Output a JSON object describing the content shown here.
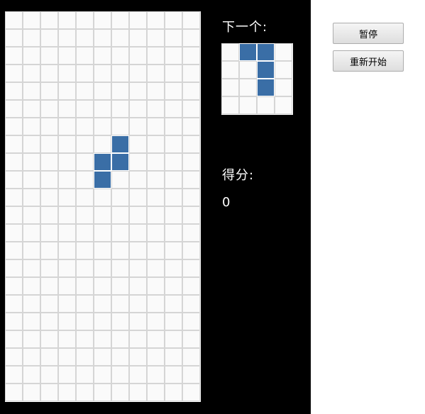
{
  "sidebar": {
    "next_label": "下一个:",
    "score_label": "得分:",
    "score_value": "0"
  },
  "controls": {
    "pause_label": "暂停",
    "restart_label": "重新开始"
  },
  "board": {
    "columns": 11,
    "rows": 22,
    "filled_cells": [
      [
        6,
        7
      ],
      [
        5,
        8
      ],
      [
        6,
        8
      ],
      [
        5,
        9
      ]
    ]
  },
  "next_piece": {
    "columns": 4,
    "rows": 4,
    "filled_cells": [
      [
        1,
        0
      ],
      [
        2,
        0
      ],
      [
        2,
        1
      ],
      [
        2,
        2
      ]
    ]
  },
  "colors": {
    "block": "#3a6ea6",
    "panel": "#000000",
    "grid_line": "#d5d5d5"
  }
}
